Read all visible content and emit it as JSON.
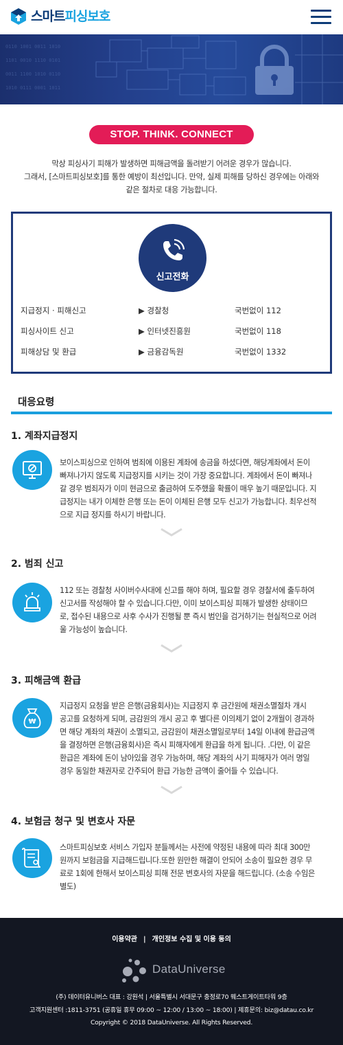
{
  "header": {
    "logo_part1": "스마트",
    "logo_part2": "피싱보호",
    "logo_icon": "shield-arrow-logo",
    "menu_icon": "hamburger-icon"
  },
  "banner": {
    "image": "security-padlock-banner"
  },
  "slogan": "STOP. THINK. CONNECT",
  "intro": {
    "line1": "막상 피싱사기 피해가 발생하면 피해금액을 돌려받기 어려운 경우가 많습니다.",
    "line2": "그래서, [스마트피싱보호]를 통한 예방이 최선입니다. 만약, 실제 피해를 당하신 경우에는 아래와",
    "line3": "같은 절차로 대응 가능합니다."
  },
  "report": {
    "title": "신고전화",
    "icon": "phone-icon",
    "rows": [
      {
        "type": "지급정지 · 피해신고",
        "agency": "▶ 경찰청",
        "number": "국번없이 112"
      },
      {
        "type": "피싱사이트 신고",
        "agency": "▶ 인터넷진흥원",
        "number": "국번없이 118"
      },
      {
        "type": "피해상담 및 환급",
        "agency": "▶ 금융감독원",
        "number": "국번없이 1332"
      }
    ]
  },
  "response": {
    "heading": "대응요령",
    "steps": [
      {
        "title": "1. 계좌지급정지",
        "icon": "monitor-block-icon",
        "lines": [
          "보이스피싱으로 인하여 범죄에 이용된 계좌에 송금을 하셨다면, 해당계좌에서 돈이",
          "빠져나가지 않도록 지급정지를 시키는 것이 가장 중요합니다. 계좌에서 돈이 빠져나",
          "갈 경우 범죄자가 이미 현금으로 출금하여 도주했을 확률이 매우 높기 때문입니다. 지",
          "급정지는 내가 이체한 은행 또는 돈이 이체된 은행 모두 신고가 가능합니다. 최우선적",
          "으로 지급 정지를 하시기 바랍니다."
        ]
      },
      {
        "title": "2. 범죄 신고",
        "icon": "siren-icon",
        "lines": [
          "112 또는 경찰청 사이버수사대에 신고를 해야 하며, 필요할 경우 경찰서에 출두하여",
          "신고서를 작성해야 할 수 있습니다.다만, 이미 보이스피싱 피해가 발생한 상태이므",
          "로, 접수된 내용으로 사후 수사가 진행될 뿐 즉시 범인을 검거하기는 현실적으로 어려",
          "울 가능성이 높습니다."
        ]
      },
      {
        "title": "3. 피해금액 환급",
        "icon": "money-bag-icon",
        "lines": [
          "지급정지 요청을 받은 은행(금융회사)는 지급정지 후 금간원에 채권소멸절차 개시",
          "공고를 요청하게 되며, 금감원의 개시 공고 후 별다른 이의제기 없이 2개월이 경과하",
          "면 해당 계좌의 채권이 소멸되고, 금감원이 채권소멸일로부터 14일 이내에 환급금액",
          "을 결정하면 은행(금융회사)은 즉시 피해자에게 환급을 하게 됩니다. .다만, 이 같은",
          "환급은 계좌에 돈이 남아있을 경우 가능하며, 해당 계좌의 사기 피해자가 여러 명일",
          "경우 동일한 채권자로 간주되어 환급 가능한 금액이 줄어들 수 있습니다."
        ]
      },
      {
        "title": "4. 보험금 청구 및 변호사 자문",
        "icon": "certificate-scroll-icon",
        "lines": [
          "스마트피싱보호 서비스 가입자 분들께서는 사전에 약정된 내용에 따라 최대 300만",
          "원까지 보험금을 지급해드립니다.또한 원만한 해결이 안되어 소송이 필요한 경우 무",
          "료로 1회에 한해서 보이스피싱 피해 전문 변호사의 자문을 해드립니다. (소송 수임은",
          "별도)"
        ]
      }
    ],
    "chevron_icon": "chevron-down-icon"
  },
  "footer": {
    "link_terms": "이용약관",
    "link_separator": "|",
    "link_privacy": "개인정보 수집 및 이용 동의",
    "brand_name": "DataUniverse",
    "brand_icon": "molecule-logo-icon",
    "info_line1": "(주) 데이터유니버스 대표 : 강원석 | 서울특별시 서대문구 충정로70 웨스트게이트타워 9층",
    "info_line2": "고객지원센터 :1811-3751 (공휴일 휴무 09:00 ~ 12:00 / 13:00 ~ 18:00) | 제휴문의: biz@datau.co.kr",
    "copyright": "Copyright © 2018 DataUniverse. All Rights Reserved."
  }
}
